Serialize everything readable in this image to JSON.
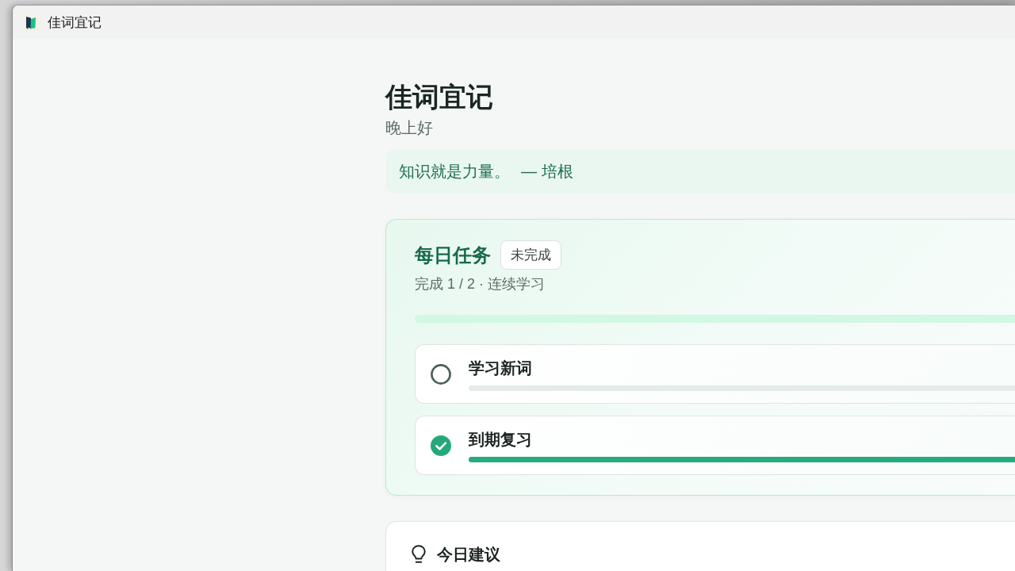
{
  "window": {
    "title": "佳词宜记"
  },
  "header": {
    "title": "佳词宜记",
    "greeting": "晚上好"
  },
  "quote": {
    "text": "知识就是力量。",
    "author": "— 培根"
  },
  "daily_tasks": {
    "title": "每日任务",
    "badge": "未完成",
    "summary": "完成 1 / 2 · 连续学习",
    "items": [
      {
        "label": "学习新词",
        "done": false
      },
      {
        "label": "到期复习",
        "done": true,
        "level": 1
      }
    ]
  },
  "suggestions": {
    "title": "今日建议"
  }
}
